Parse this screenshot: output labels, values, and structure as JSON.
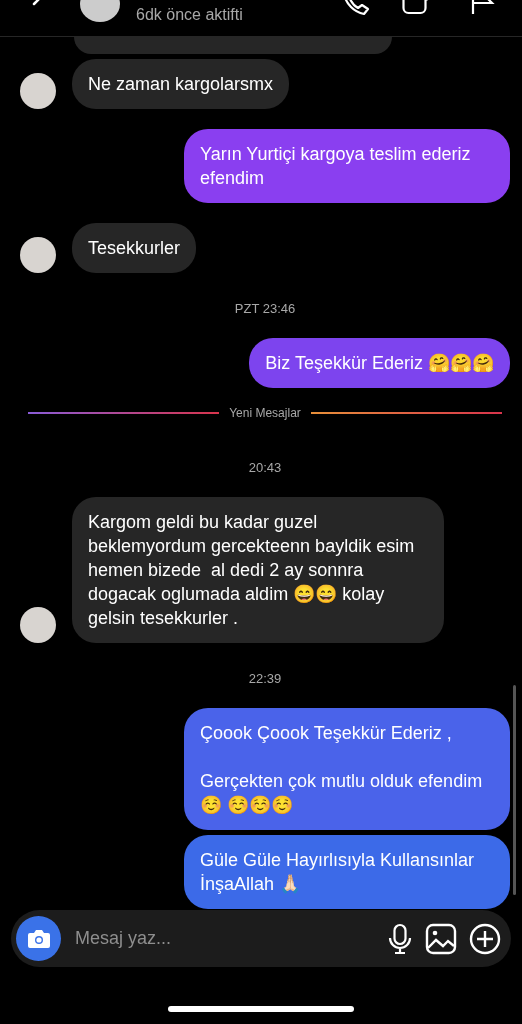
{
  "header": {
    "status": "6dk önce aktifti"
  },
  "messages": [
    {
      "kind": "clipped"
    },
    {
      "kind": "incoming",
      "text": "Ne zaman kargolarsmx"
    },
    {
      "kind": "outgoing",
      "text": "Yarın Yurtiçi kargoya teslim ederiz efendim",
      "color": "#8a3ff0"
    },
    {
      "kind": "incoming",
      "text": "Tesekkurler"
    },
    {
      "kind": "time",
      "text": "PZT 23:46"
    },
    {
      "kind": "outgoing",
      "text": "Biz Teşekkür Ederiz 🤗🤗🤗",
      "color": "#7d44ee"
    },
    {
      "kind": "divider",
      "text": "Yeni Mesajlar"
    },
    {
      "kind": "time",
      "text": "20:43"
    },
    {
      "kind": "incoming",
      "text": "Kargom geldi bu kadar guzel beklemyordum gercekteenn bayldik esim hemen bizede  al dedi 2 ay sonnra dogacak oglumada aldim 😄😄 kolay gelsin tesekkurler ."
    },
    {
      "kind": "time",
      "text": "22:39"
    },
    {
      "kind": "outgoing",
      "text": "Çoook Çoook Teşekkür Ederiz ,\n\nGerçekten çok mutlu olduk efendim ☺️ ☺️☺️☺️",
      "color": "#4a63ea"
    },
    {
      "kind": "outgoing",
      "text": "Güle Güle Hayırlısıyla Kullansınlar İnşaAllah 🙏🏻",
      "color": "#3c6ae8"
    }
  ],
  "composer": {
    "placeholder": "Mesaj yaz..."
  }
}
